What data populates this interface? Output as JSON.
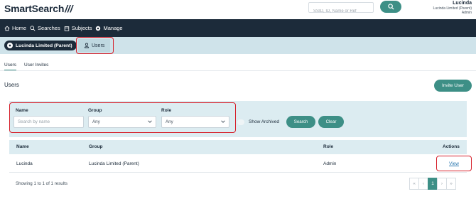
{
  "header": {
    "logo_text": "SmartSearch",
    "logo_slashes": "///",
    "search_placeholder": "SSID, ID, Name or Ref",
    "user_name": "Lucinda",
    "user_org": "Lucinda Limited (Parent)",
    "user_role": "Admin"
  },
  "nav": {
    "items": [
      {
        "label": "Home",
        "icon": "home-icon"
      },
      {
        "label": "Searches",
        "icon": "search-icon"
      },
      {
        "label": "Subjects",
        "icon": "calendar-icon"
      },
      {
        "label": "Manage",
        "icon": "gear-icon"
      }
    ]
  },
  "context": {
    "org_label": "Lucinda Limited (Parent)",
    "users_tab_label": "Users"
  },
  "subtabs": [
    {
      "label": "Users",
      "active": true
    },
    {
      "label": "User Invites",
      "active": false
    }
  ],
  "page": {
    "title": "Users",
    "invite_button": "Invite User"
  },
  "filters": {
    "name_label": "Name",
    "name_placeholder": "Search by name",
    "group_label": "Group",
    "group_value": "Any",
    "role_label": "Role",
    "role_value": "Any",
    "archived_label": "Show Archived",
    "search_button": "Search",
    "clear_button": "Clear"
  },
  "table": {
    "columns": [
      "Name",
      "Group",
      "Role",
      "Actions"
    ],
    "rows": [
      {
        "name": "Lucinda",
        "group": "Lucinda Limited (Parent)",
        "role": "Admin",
        "action": "View"
      }
    ]
  },
  "footer": {
    "showing_text": "Showing 1 to 1 of 1 results",
    "pager": [
      "«",
      "‹",
      "1",
      "›",
      "»"
    ],
    "current_page": "1"
  },
  "colors": {
    "accent": "#3d8f86",
    "navbar": "#1c2b3a",
    "context_bar": "#cfe3ea",
    "annotation": "#d6202b"
  }
}
